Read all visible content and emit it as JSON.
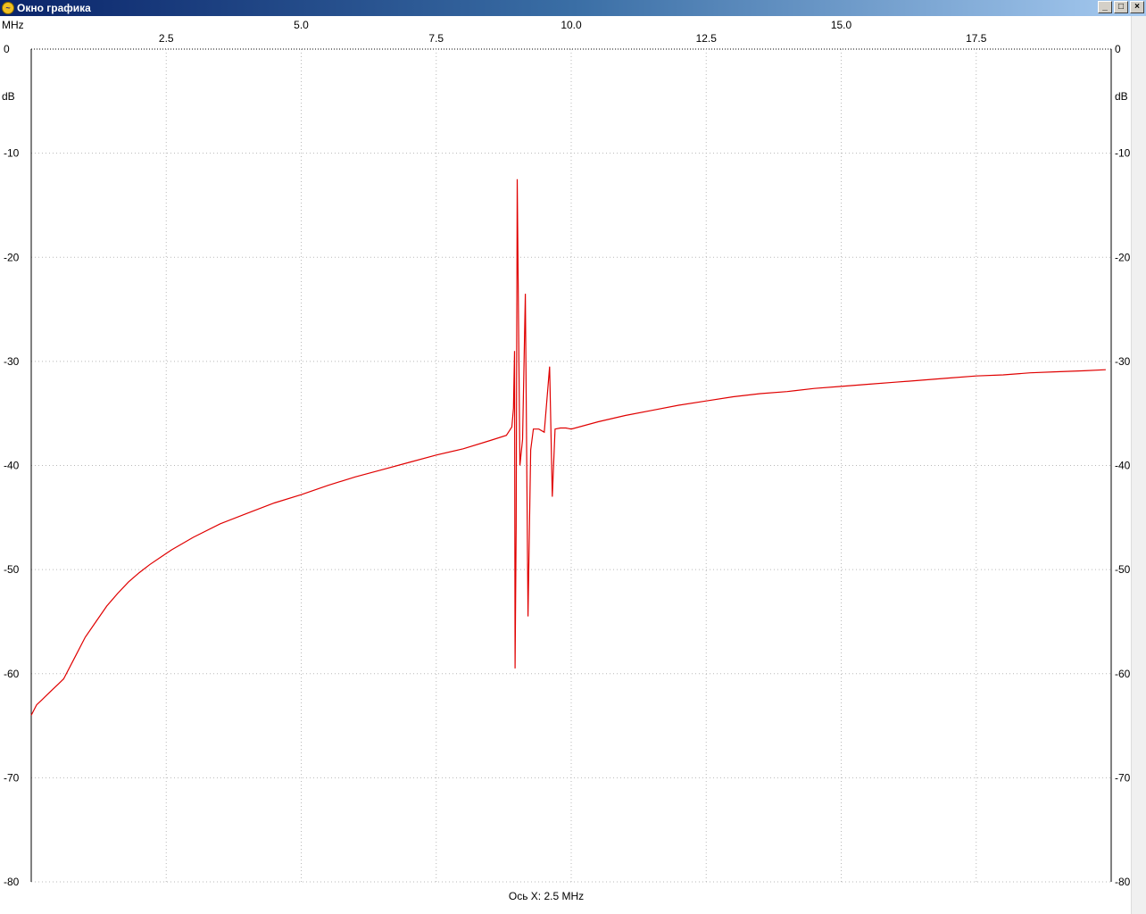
{
  "window": {
    "title": "Окно графика",
    "icon": "chart-app-icon",
    "controls": {
      "minimize": "_",
      "maximize": "□",
      "close": "×"
    }
  },
  "colors": {
    "trace": "#e00000",
    "grid": "#b8b8b8",
    "title_gradient_start": "#0a246a",
    "title_gradient_end": "#a6caf0"
  },
  "chart_data": {
    "type": "line",
    "xlabel_unit": "MHz",
    "ylabel_unit": "dB",
    "footer": "Ось X: 2.5 MHz",
    "xlim": [
      0,
      20
    ],
    "ylim": [
      -80,
      0
    ],
    "x_ticks_upper": [
      "5.0",
      "10.0",
      "15.0"
    ],
    "x_ticks_upper_values": [
      5,
      10,
      15
    ],
    "x_ticks_lower": [
      "2.5",
      "7.5",
      "12.5",
      "17.5"
    ],
    "x_ticks_lower_values": [
      2.5,
      7.5,
      12.5,
      17.5
    ],
    "y_ticks": [
      "0",
      "-10",
      "-20",
      "-30",
      "-40",
      "-50",
      "-60",
      "-70",
      "-80"
    ],
    "y_tick_values": [
      0,
      -10,
      -20,
      -30,
      -40,
      -50,
      -60,
      -70,
      -80
    ],
    "grid": true,
    "series": [
      {
        "x": [
          0.0,
          0.1,
          0.2,
          0.3,
          0.4,
          0.5,
          0.6,
          0.8,
          1.0,
          1.2,
          1.4,
          1.6,
          1.8,
          2.0,
          2.2,
          2.4,
          2.6,
          2.8,
          3.0,
          3.5,
          4.0,
          4.5,
          5.0,
          5.5,
          6.0,
          6.5,
          7.0,
          7.5,
          8.0,
          8.5,
          8.8,
          8.9,
          8.93,
          8.95,
          8.96,
          8.98,
          9.0,
          9.05,
          9.1,
          9.15,
          9.2,
          9.25,
          9.3,
          9.4,
          9.5,
          9.6,
          9.65,
          9.7,
          9.8,
          9.9,
          10.0,
          10.5,
          11.0,
          11.5,
          12.0,
          12.5,
          13.0,
          13.5,
          14.0,
          14.5,
          15.0,
          15.5,
          16.0,
          16.5,
          17.0,
          17.5,
          18.0,
          18.5,
          19.0,
          19.5,
          19.9
        ],
        "y": [
          -64.0,
          -63.0,
          -62.5,
          -62.0,
          -61.5,
          -61.0,
          -60.5,
          -58.5,
          -56.5,
          -55.0,
          -53.5,
          -52.3,
          -51.2,
          -50.3,
          -49.5,
          -48.8,
          -48.1,
          -47.5,
          -46.9,
          -45.6,
          -44.6,
          -43.6,
          -42.8,
          -41.9,
          -41.1,
          -40.4,
          -39.7,
          -39.0,
          -38.4,
          -37.6,
          -37.1,
          -36.3,
          -34.5,
          -29.0,
          -59.5,
          -46.0,
          -12.5,
          -40.0,
          -37.5,
          -23.5,
          -54.5,
          -38.5,
          -36.5,
          -36.5,
          -36.8,
          -30.5,
          -43.0,
          -36.5,
          -36.4,
          -36.4,
          -36.5,
          -35.8,
          -35.2,
          -34.7,
          -34.2,
          -33.8,
          -33.4,
          -33.1,
          -32.9,
          -32.6,
          -32.4,
          -32.2,
          -32.0,
          -31.8,
          -31.6,
          -31.4,
          -31.3,
          -31.1,
          -31.0,
          -30.9,
          -30.8
        ]
      }
    ]
  }
}
